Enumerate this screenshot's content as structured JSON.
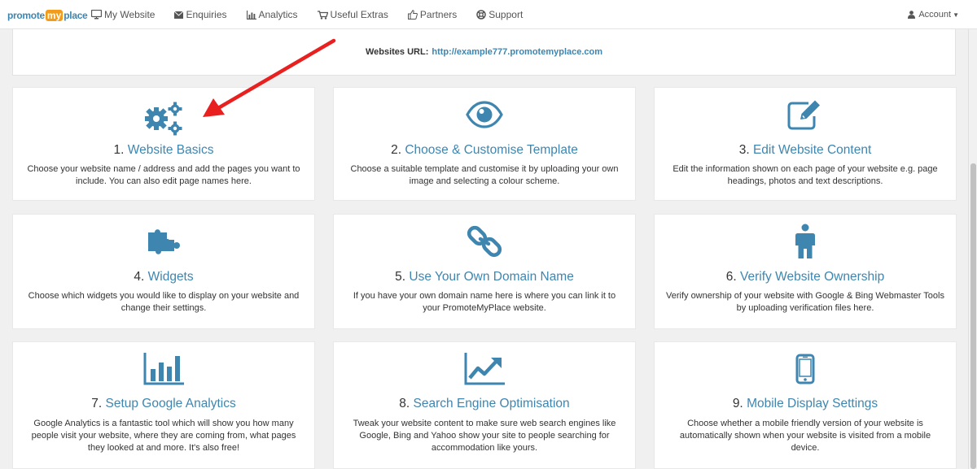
{
  "brand": {
    "part1": "promote",
    "part2": "my",
    "part3": "place"
  },
  "nav": {
    "items": [
      {
        "label": "My Website",
        "icon": "monitor-icon"
      },
      {
        "label": "Enquiries",
        "icon": "envelope-icon"
      },
      {
        "label": "Analytics",
        "icon": "bar-chart-icon"
      },
      {
        "label": "Useful Extras",
        "icon": "cart-icon"
      },
      {
        "label": "Partners",
        "icon": "thumbs-up-icon"
      },
      {
        "label": "Support",
        "icon": "lifebuoy-icon"
      }
    ],
    "account_label": "Account"
  },
  "website_url": {
    "label": "Websites URL:",
    "url": "http://example777.promotemyplace.com"
  },
  "colors": {
    "accent": "#3e86b0",
    "arrow": "#e8201f",
    "logo_orange": "#f39c1a"
  },
  "cards": [
    {
      "number": "1.",
      "title": "Website Basics",
      "icon": "cogs-icon",
      "lines": [
        "Choose your website name / address and add the pages you want to",
        "include. You can also edit page names here."
      ]
    },
    {
      "number": "2.",
      "title": "Choose & Customise Template",
      "icon": "eye-icon",
      "lines": [
        "Choose a suitable template and customise it by uploading your own",
        "image and selecting a colour scheme."
      ]
    },
    {
      "number": "3.",
      "title": "Edit Website Content",
      "icon": "edit-icon",
      "lines": [
        "Edit the information shown on each page of your website e.g. page",
        "headings, photos and text descriptions."
      ]
    },
    {
      "number": "4.",
      "title": "Widgets",
      "icon": "puzzle-icon",
      "lines": [
        "Choose which widgets you would like to display on your website and",
        "change their settings."
      ]
    },
    {
      "number": "5.",
      "title": "Use Your Own Domain Name",
      "icon": "link-icon",
      "lines": [
        "If you have your own domain name here is where you can link it to",
        "your PromoteMyPlace website."
      ]
    },
    {
      "number": "6.",
      "title": "Verify Website Ownership",
      "icon": "person-icon",
      "lines": [
        "Verify ownership of your website with Google & Bing Webmaster Tools",
        "by uploading verification files here."
      ]
    },
    {
      "number": "7.",
      "title": "Setup Google Analytics",
      "icon": "bar-chart-icon",
      "lines": [
        "Google Analytics is a fantastic tool which will show you how many",
        "people visit your website, where they are coming from, what pages",
        "they looked at and more. It's also free!"
      ]
    },
    {
      "number": "8.",
      "title": "Search Engine Optimisation",
      "icon": "line-chart-icon",
      "lines": [
        "Tweak your website content to make sure web search engines like",
        "Google, Bing and Yahoo show your site to people searching for",
        "accommodation like yours."
      ]
    },
    {
      "number": "9.",
      "title": "Mobile Display Settings",
      "icon": "mobile-icon",
      "lines": [
        "Choose whether a mobile friendly version of your website is",
        "automatically shown when your website is visited from a mobile",
        "device."
      ]
    }
  ]
}
